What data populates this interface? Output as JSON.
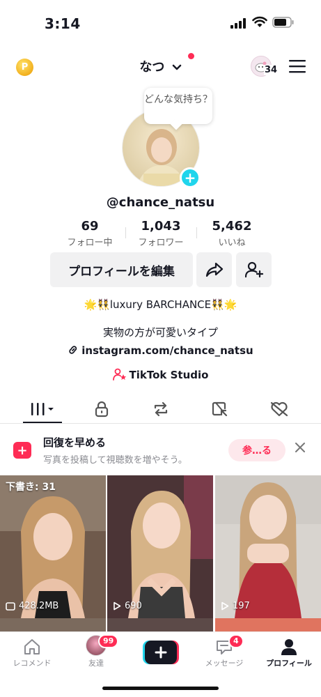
{
  "status_bar": {
    "time": "3:14"
  },
  "header": {
    "username": "なつ",
    "friend_count": "34",
    "icons": [
      "coin-icon",
      "chevron-down-icon",
      "friends-avatar-icon",
      "menu-icon"
    ]
  },
  "profile": {
    "bubble_text": "どんな気持ち？",
    "handle": "@chance_natsu",
    "stats": [
      {
        "num": "69",
        "label": "フォロー中"
      },
      {
        "num": "1,043",
        "label": "フォロワー"
      },
      {
        "num": "5,462",
        "label": "いいね"
      }
    ],
    "edit_label": "プロフィールを編集",
    "bio_line1": "🌟👯luxury BARCHANCE👯🌟",
    "bio_line2": "実物の方が可愛いタイプ",
    "link": "instagram.com/chance_natsu",
    "studio": "TikTok Studio"
  },
  "tabs": [
    "grid-icon",
    "lock-icon",
    "repost-icon",
    "tagged-icon",
    "liked-icon"
  ],
  "banner": {
    "title": "回復を早める",
    "subtitle": "写真を投稿して視聴数を増やそう。",
    "button": "参…る"
  },
  "videos": [
    {
      "top": "下書き: 31",
      "bottom": "428.2MB",
      "bottom_icon": "drafts-icon"
    },
    {
      "top": "",
      "bottom": "690",
      "bottom_icon": "play-icon"
    },
    {
      "top": "",
      "bottom": "197",
      "bottom_icon": "play-icon"
    }
  ],
  "bottom_nav": [
    {
      "label": "レコメンド"
    },
    {
      "label": "友達",
      "badge": "99"
    },
    {
      "label": ""
    },
    {
      "label": "メッセージ",
      "badge": "4"
    },
    {
      "label": "プロフィール"
    }
  ],
  "colors": {
    "accent": "#fe2c55",
    "cyan": "#20d5ec"
  }
}
